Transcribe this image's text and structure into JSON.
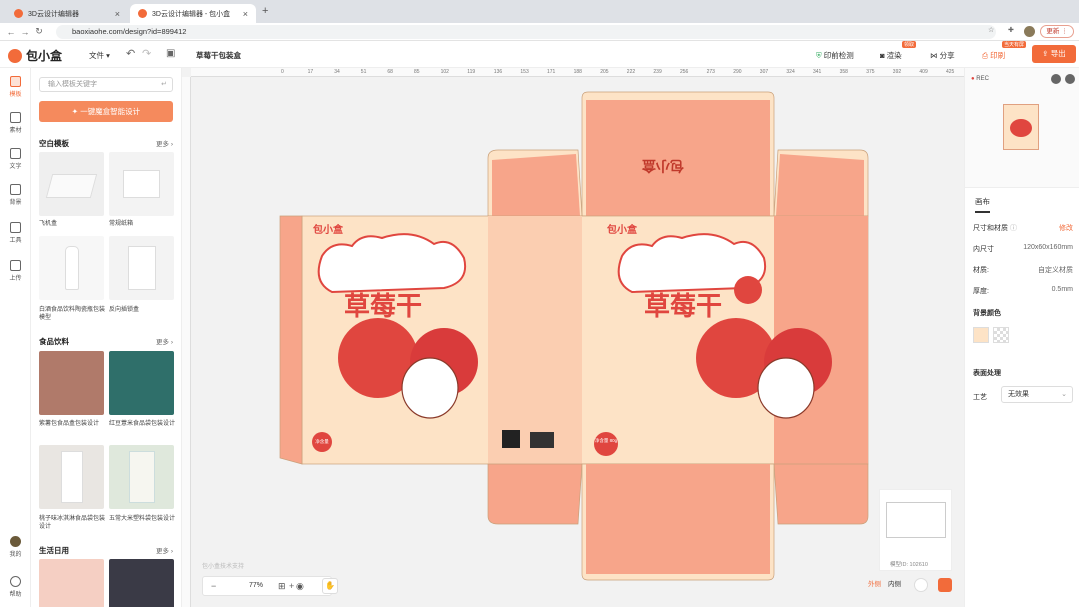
{
  "browser": {
    "tabs": [
      {
        "title": "3D云设计编辑器"
      },
      {
        "title": "3D云设计编辑器 - 包小盒"
      }
    ],
    "url": "baoxiaohe.com/design?id=899412",
    "update_label": "更新"
  },
  "app": {
    "logo": "包小盒",
    "file_menu": "文件",
    "doc_title": "草莓干包装盒",
    "preflight": "印前检测",
    "render": "渲染",
    "render_badge": "领取",
    "share": "分享",
    "print": "印刷",
    "print_badge": "当天有屏",
    "export": "导出"
  },
  "sidebar": {
    "items": [
      {
        "label": "模板"
      },
      {
        "label": "素材"
      },
      {
        "label": "文字"
      },
      {
        "label": "背景"
      },
      {
        "label": "工具"
      },
      {
        "label": "上传"
      }
    ],
    "mine": "我的",
    "help": "帮助"
  },
  "left_panel": {
    "search_placeholder": "输入模板关键字",
    "smart_button": "一键魔盒智能设计",
    "more": "更多",
    "sections": [
      {
        "title": "空白模板",
        "items": [
          {
            "label": "飞机盒",
            "color": "#e8e8e8"
          },
          {
            "label": "常规纸箱",
            "color": "#ececec"
          },
          {
            "label": "白酒食品饮料陶瓷瓶包装模型",
            "color": "#f4f4f4"
          },
          {
            "label": "反向插锁盒",
            "color": "#f2f2f2"
          }
        ]
      },
      {
        "title": "食品饮料",
        "items": [
          {
            "label": "紫薯包食品盒包装设计",
            "color": "#b07a6a"
          },
          {
            "label": "红豆薏米食品袋包装设计",
            "color": "#2f6f6a"
          },
          {
            "label": "桃子味冰淇淋食品袋包装设计",
            "color": "#e9e6e2"
          },
          {
            "label": "五常大米塑料袋包装设计",
            "color": "#dfe8dc"
          }
        ]
      },
      {
        "title": "生活日用",
        "items": []
      }
    ]
  },
  "canvas": {
    "ruler_ticks": [
      "0",
      "17",
      "34",
      "51",
      "68",
      "85",
      "102",
      "119",
      "136",
      "153",
      "171",
      "188",
      "205",
      "222",
      "239",
      "256",
      "273",
      "290",
      "307",
      "324",
      "341",
      "358",
      "375",
      "392",
      "409",
      "425"
    ],
    "box_texts": {
      "brand": "包小盒",
      "title": "草莓干",
      "badge_front": "净含量",
      "badge_side": "净含量 80g"
    },
    "zoom": "77%",
    "watermark": "包小盒技术支持",
    "outer_label": "外侧",
    "inner_label": "内侧",
    "model_id": "模型ID: 102610"
  },
  "right_panel": {
    "rec": "REC",
    "tab": "画布",
    "size_label": "尺寸和材质",
    "edit": "修改",
    "inner_size_label": "内尺寸",
    "inner_size": "120x60x160mm",
    "material_label": "材质:",
    "material": "自定义材质",
    "thickness_label": "厚度:",
    "thickness": "0.5mm",
    "bg_color_label": "背景颜色",
    "surface_label": "表面处理",
    "craft_label": "工艺",
    "craft_value": "无效果"
  },
  "colors": {
    "accent": "#f26b3a",
    "box_salmon": "#f7a58a",
    "box_cream": "#fde3c6",
    "strawberry": "#e0463f"
  }
}
